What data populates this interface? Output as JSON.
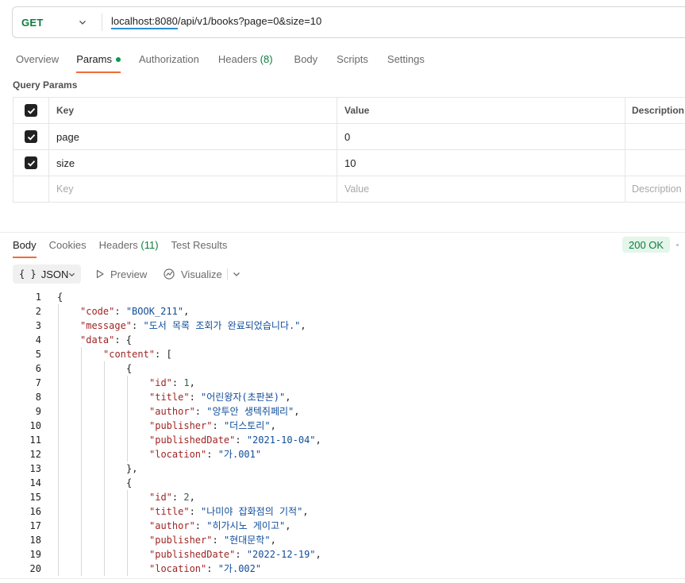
{
  "request": {
    "method": "GET",
    "url_host": "localhost:8080",
    "url_rest": "/api/v1/books?page=0&size=10"
  },
  "request_tabs": [
    {
      "label": "Overview"
    },
    {
      "label": "Params",
      "active": true
    },
    {
      "label": "Authorization"
    },
    {
      "label": "Headers",
      "count": "(8)"
    },
    {
      "label": "Body"
    },
    {
      "label": "Scripts"
    },
    {
      "label": "Settings"
    }
  ],
  "params": {
    "title": "Query Params",
    "headers": {
      "key": "Key",
      "value": "Value",
      "description": "Description"
    },
    "rows": [
      {
        "checked": true,
        "key": "page",
        "value": "0"
      },
      {
        "checked": true,
        "key": "size",
        "value": "10"
      }
    ],
    "placeholder": {
      "key": "Key",
      "value": "Value",
      "description": "Description"
    }
  },
  "response_tabs": [
    {
      "label": "Body",
      "active": true
    },
    {
      "label": "Cookies"
    },
    {
      "label": "Headers",
      "count": "(11)"
    },
    {
      "label": "Test Results"
    }
  ],
  "status": {
    "text": "200 OK",
    "color": "#0b7d3e"
  },
  "toolbar": {
    "format_braces": "{ }",
    "format_label": "JSON",
    "preview_label": "Preview",
    "visualize_label": "Visualize"
  },
  "code_lines": [
    {
      "n": "1",
      "depth": 0,
      "t": [
        [
          "p",
          "{"
        ]
      ]
    },
    {
      "n": "2",
      "depth": 1,
      "t": [
        [
          "k",
          "\"code\""
        ],
        [
          "p",
          ": "
        ],
        [
          "s",
          "\"BOOK_211\""
        ],
        [
          "p",
          ","
        ]
      ]
    },
    {
      "n": "3",
      "depth": 1,
      "t": [
        [
          "k",
          "\"message\""
        ],
        [
          "p",
          ": "
        ],
        [
          "s",
          "\"도서 목록 조회가 완료되었습니다.\""
        ],
        [
          "p",
          ","
        ]
      ]
    },
    {
      "n": "4",
      "depth": 1,
      "t": [
        [
          "k",
          "\"data\""
        ],
        [
          "p",
          ": {"
        ]
      ]
    },
    {
      "n": "5",
      "depth": 2,
      "t": [
        [
          "k",
          "\"content\""
        ],
        [
          "p",
          ": ["
        ]
      ]
    },
    {
      "n": "6",
      "depth": 3,
      "t": [
        [
          "p",
          "{"
        ]
      ]
    },
    {
      "n": "7",
      "depth": 4,
      "t": [
        [
          "k",
          "\"id\""
        ],
        [
          "p",
          ": "
        ],
        [
          "n",
          "1"
        ],
        [
          "p",
          ","
        ]
      ]
    },
    {
      "n": "8",
      "depth": 4,
      "t": [
        [
          "k",
          "\"title\""
        ],
        [
          "p",
          ": "
        ],
        [
          "s",
          "\"어린왕자(초판본)\""
        ],
        [
          "p",
          ","
        ]
      ]
    },
    {
      "n": "9",
      "depth": 4,
      "t": [
        [
          "k",
          "\"author\""
        ],
        [
          "p",
          ": "
        ],
        [
          "s",
          "\"앙투안 생텍쥐페리\""
        ],
        [
          "p",
          ","
        ]
      ]
    },
    {
      "n": "10",
      "depth": 4,
      "t": [
        [
          "k",
          "\"publisher\""
        ],
        [
          "p",
          ": "
        ],
        [
          "s",
          "\"더스토리\""
        ],
        [
          "p",
          ","
        ]
      ]
    },
    {
      "n": "11",
      "depth": 4,
      "t": [
        [
          "k",
          "\"publishedDate\""
        ],
        [
          "p",
          ": "
        ],
        [
          "s",
          "\"2021-10-04\""
        ],
        [
          "p",
          ","
        ]
      ]
    },
    {
      "n": "12",
      "depth": 4,
      "t": [
        [
          "k",
          "\"location\""
        ],
        [
          "p",
          ": "
        ],
        [
          "s",
          "\"가.001\""
        ]
      ]
    },
    {
      "n": "13",
      "depth": 3,
      "t": [
        [
          "p",
          "},"
        ]
      ]
    },
    {
      "n": "14",
      "depth": 3,
      "t": [
        [
          "p",
          "{"
        ]
      ]
    },
    {
      "n": "15",
      "depth": 4,
      "t": [
        [
          "k",
          "\"id\""
        ],
        [
          "p",
          ": "
        ],
        [
          "n",
          "2"
        ],
        [
          "p",
          ","
        ]
      ]
    },
    {
      "n": "16",
      "depth": 4,
      "t": [
        [
          "k",
          "\"title\""
        ],
        [
          "p",
          ": "
        ],
        [
          "s",
          "\"나미야 잡화점의 기적\""
        ],
        [
          "p",
          ","
        ]
      ]
    },
    {
      "n": "17",
      "depth": 4,
      "t": [
        [
          "k",
          "\"author\""
        ],
        [
          "p",
          ": "
        ],
        [
          "s",
          "\"히가시노 게이고\""
        ],
        [
          "p",
          ","
        ]
      ]
    },
    {
      "n": "18",
      "depth": 4,
      "t": [
        [
          "k",
          "\"publisher\""
        ],
        [
          "p",
          ": "
        ],
        [
          "s",
          "\"현대문학\""
        ],
        [
          "p",
          ","
        ]
      ]
    },
    {
      "n": "19",
      "depth": 4,
      "t": [
        [
          "k",
          "\"publishedDate\""
        ],
        [
          "p",
          ": "
        ],
        [
          "s",
          "\"2022-12-19\""
        ],
        [
          "p",
          ","
        ]
      ]
    },
    {
      "n": "20",
      "depth": 4,
      "t": [
        [
          "k",
          "\"location\""
        ],
        [
          "p",
          ": "
        ],
        [
          "s",
          "\"가.002\""
        ]
      ]
    }
  ],
  "icons": {
    "method_chevron": "chevron-down-icon",
    "format_chevron": "chevron-down-icon",
    "preview": "play-icon",
    "visualize": "visualize-icon",
    "visualize_menu": "chevron-down-icon",
    "checkbox": "checkbox-checked-icon"
  }
}
